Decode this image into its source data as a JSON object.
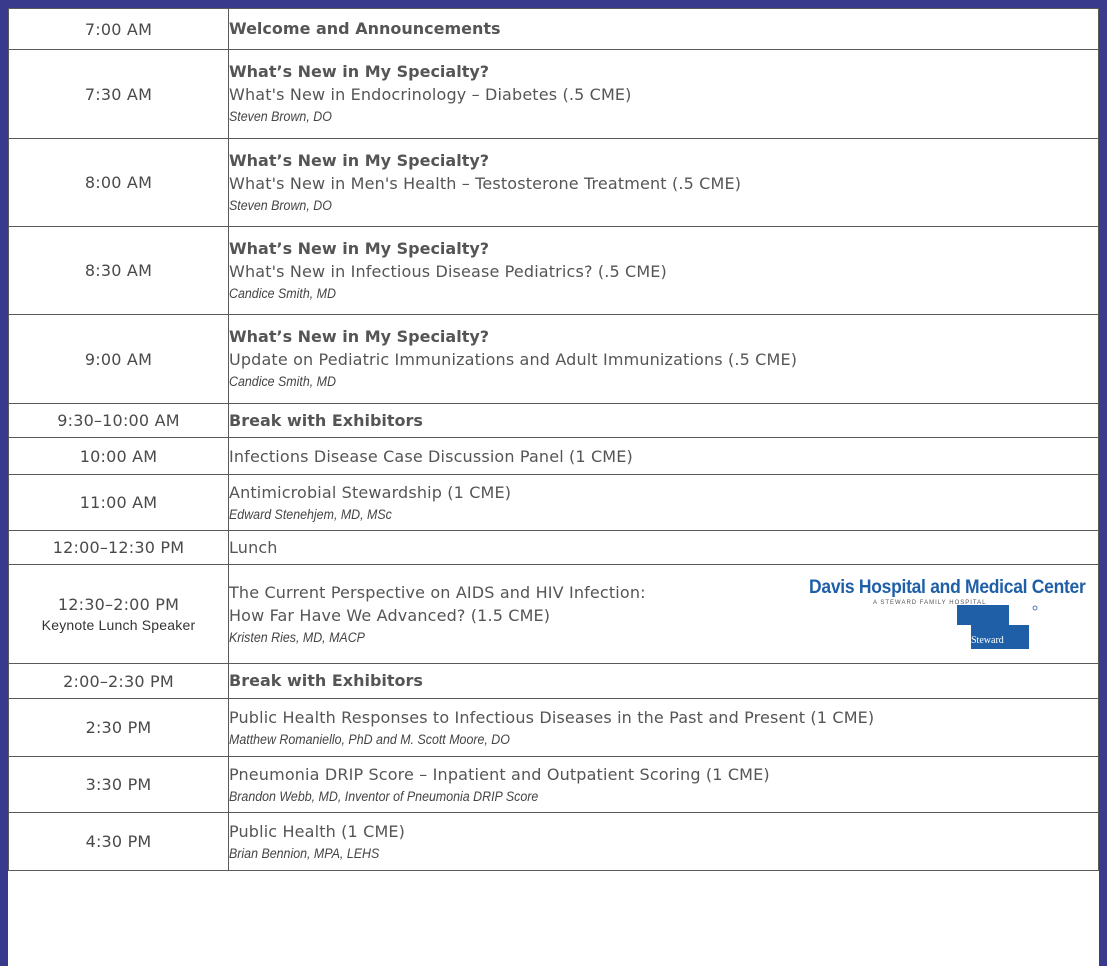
{
  "rows": [
    {
      "time": "7:00 AM",
      "title": "Welcome and Announcements",
      "desc": "",
      "speaker": ""
    },
    {
      "time": "7:30 AM",
      "title": "What’s New in My Specialty?",
      "desc": "What's New in Endocrinology – Diabetes (.5 CME)",
      "speaker": "Steven Brown, DO"
    },
    {
      "time": "8:00 AM",
      "title": "What’s New in My Specialty?",
      "desc": "What's New in Men's Health – Testosterone Treatment (.5 CME)",
      "speaker": "Steven Brown, DO"
    },
    {
      "time": "8:30 AM",
      "title": "What’s New in My Specialty?",
      "desc": "What's New in Infectious Disease Pediatrics? (.5 CME)",
      "speaker": "Candice Smith, MD"
    },
    {
      "time": "9:00 AM",
      "title": "What’s New in My Specialty?",
      "desc": "Update on Pediatric Immunizations and Adult Immunizations (.5 CME)",
      "speaker": "Candice Smith, MD"
    },
    {
      "time": "9:30–10:00 AM",
      "title": "Break with Exhibitors",
      "desc": "",
      "speaker": ""
    },
    {
      "time": "10:00 AM",
      "title": "",
      "desc": "Infections Disease Case Discussion Panel (1 CME)",
      "speaker": ""
    },
    {
      "time": "11:00 AM",
      "title": "",
      "desc": "Antimicrobial Stewardship (1 CME)",
      "speaker": "Edward Stenehjem, MD, MSc"
    },
    {
      "time": "12:00–12:30 PM",
      "title": "",
      "desc": "Lunch",
      "speaker": ""
    },
    {
      "time": "12:30–2:00 PM",
      "time_sub": "Keynote Lunch Speaker",
      "title": "",
      "desc": "The Current Perspective on AIDS and HIV Infection:",
      "desc2": "How Far Have We Advanced? (1.5 CME)",
      "speaker": "Kristen Ries, MD, MACP"
    },
    {
      "time": "2:00–2:30 PM",
      "title": "Break with Exhibitors",
      "desc": "",
      "speaker": ""
    },
    {
      "time": "2:30 PM",
      "title": "",
      "desc": "Public Health Responses to Infectious Diseases in the Past and Present (1 CME)",
      "speaker": "Matthew Romaniello, PhD and M. Scott Moore, DO"
    },
    {
      "time": "3:30 PM",
      "title": "",
      "desc": "Pneumonia DRIP Score – Inpatient and Outpatient Scoring (1 CME)",
      "speaker": "Brandon Webb, MD, Inventor of Pneumonia DRIP Score"
    },
    {
      "time": "4:30 PM",
      "title": "",
      "desc": "Public Health (1 CME)",
      "speaker": "Brian Bennion, MPA, LEHS"
    }
  ],
  "sponsor": {
    "name": "Davis Hospital and Medical Center",
    "tagline": "A STEWARD FAMILY HOSPITAL",
    "mark_word": "Steward"
  },
  "colors": {
    "frame": "#3a3a8c",
    "brand_blue": "#1f5fa8"
  }
}
